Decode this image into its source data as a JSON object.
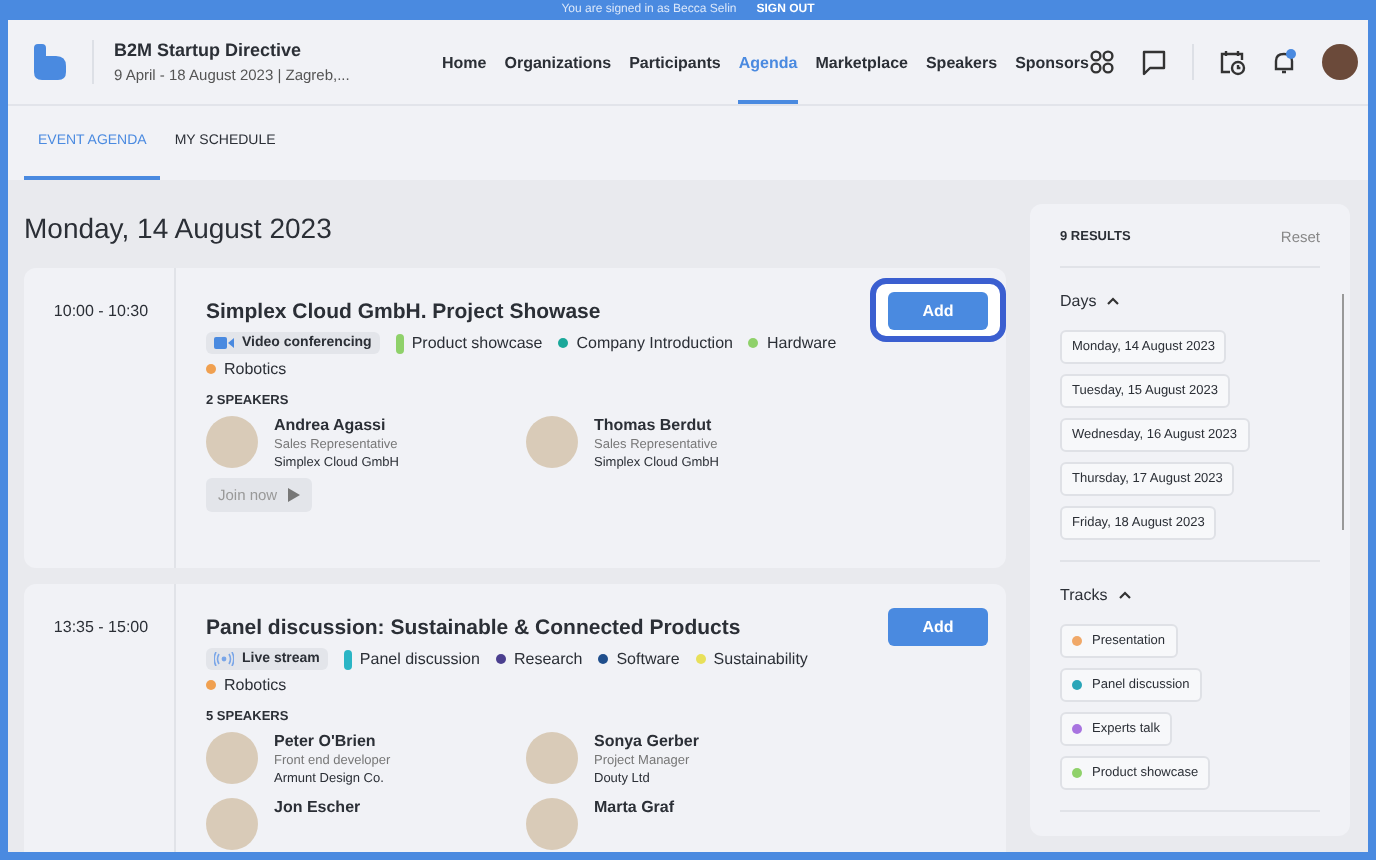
{
  "top_bar": {
    "message": "You are signed in as Becca Selin",
    "action": "SIGN OUT"
  },
  "event": {
    "title": "B2M Startup Directive",
    "subtitle": "9 April - 18 August 2023 | Zagreb,..."
  },
  "nav": [
    {
      "label": "Home",
      "selected": false
    },
    {
      "label": "Organizations",
      "selected": false
    },
    {
      "label": "Participants",
      "selected": false
    },
    {
      "label": "Agenda",
      "selected": true
    },
    {
      "label": "Marketplace",
      "selected": false
    },
    {
      "label": "Speakers",
      "selected": false
    },
    {
      "label": "Sponsors",
      "selected": false
    }
  ],
  "notifications": {
    "unread": true
  },
  "sub_tabs": [
    {
      "label": "EVENT AGENDA",
      "selected": true
    },
    {
      "label": "MY SCHEDULE",
      "selected": false
    }
  ],
  "day_heading": "Monday, 14 August 2023",
  "sessions": [
    {
      "time": "10:00 - 10:30",
      "title": "Simplex Cloud GmbH. Project Showase",
      "button": "Add",
      "highlighted": true,
      "tags": [
        {
          "kind": "video",
          "label": "Video conferencing"
        },
        {
          "kind": "track",
          "label": "Product showcase",
          "color": "#8fd16a"
        },
        {
          "kind": "topic",
          "label": "Company Introduction",
          "color": "#1aa89a"
        },
        {
          "kind": "topic",
          "label": "Hardware",
          "color": "#8fd16a"
        },
        {
          "kind": "topic",
          "label": "Robotics",
          "color": "#f0a050"
        }
      ],
      "speakers_label": "2 SPEAKERS",
      "speakers": [
        {
          "name": "Andrea Agassi",
          "role": "Sales Representative",
          "company": "Simplex Cloud GmbH"
        },
        {
          "name": "Thomas Berdut",
          "role": "Sales Representative",
          "company": "Simplex Cloud GmbH"
        }
      ],
      "join": {
        "label": "Join now",
        "disabled": true
      }
    },
    {
      "time": "13:35 - 15:00",
      "title": "Panel discussion: Sustainable & Connected Products",
      "button": "Add",
      "highlighted": false,
      "tags": [
        {
          "kind": "live",
          "label": "Live stream"
        },
        {
          "kind": "track",
          "label": "Panel discussion",
          "color": "#2bb5c5"
        },
        {
          "kind": "topic",
          "label": "Research",
          "color": "#4b3f8f"
        },
        {
          "kind": "topic",
          "label": "Software",
          "color": "#1f4e8c"
        },
        {
          "kind": "topic",
          "label": "Sustainability",
          "color": "#e8e05a"
        },
        {
          "kind": "topic",
          "label": "Robotics",
          "color": "#f0a050"
        }
      ],
      "speakers_label": "5 SPEAKERS",
      "speakers": [
        {
          "name": "Peter O'Brien",
          "role": "Front end developer",
          "company": "Armunt Design Co."
        },
        {
          "name": "Sonya Gerber",
          "role": "Project Manager",
          "company": "Douty Ltd"
        },
        {
          "name": "Jon Escher"
        },
        {
          "name": "Marta Graf"
        }
      ]
    }
  ],
  "filters": {
    "results": "9 RESULTS",
    "reset": "Reset",
    "groups": [
      {
        "title": "Days",
        "expanded": true,
        "options": [
          {
            "label": "Monday, 14 August 2023"
          },
          {
            "label": "Tuesday, 15 August 2023"
          },
          {
            "label": "Wednesday, 16 August 2023"
          },
          {
            "label": "Thursday, 17 August 2023"
          },
          {
            "label": "Friday, 18 August 2023"
          }
        ]
      },
      {
        "title": "Tracks",
        "expanded": true,
        "options": [
          {
            "label": "Presentation",
            "color": "#f0a868"
          },
          {
            "label": "Panel discussion",
            "color": "#2aa5b8"
          },
          {
            "label": "Experts talk",
            "color": "#a874e0"
          },
          {
            "label": "Product showcase",
            "color": "#8fd16a"
          }
        ]
      }
    ]
  }
}
